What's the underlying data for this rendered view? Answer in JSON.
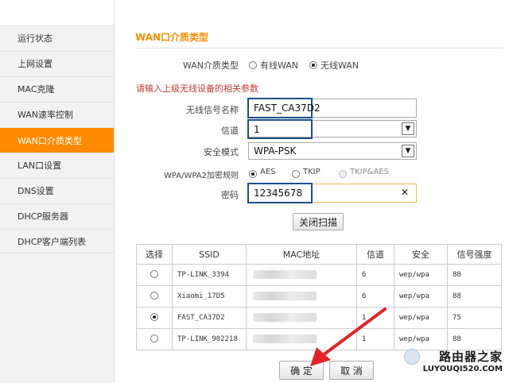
{
  "sidebar": {
    "items": [
      {
        "label": "运行状态",
        "active": false
      },
      {
        "label": "上网设置",
        "active": false
      },
      {
        "label": "MAC克隆",
        "active": false
      },
      {
        "label": "WAN速率控制",
        "active": false
      },
      {
        "label": "WAN口介质类型",
        "active": true
      },
      {
        "label": "LAN口设置",
        "active": false
      },
      {
        "label": "DNS设置",
        "active": false
      },
      {
        "label": "DHCP服务器",
        "active": false
      },
      {
        "label": "DHCP客户端列表",
        "active": false
      }
    ]
  },
  "main": {
    "title": "WAN口介质类型",
    "medium_type": {
      "label": "WAN介质类型",
      "options": [
        "有线WAN",
        "无线WAN"
      ],
      "selected": "无线WAN"
    },
    "prompt": "请输入上级无线设备的相关参数",
    "ssid": {
      "label": "无线信号名称",
      "value": "FAST_CA37D2"
    },
    "channel": {
      "label": "信道",
      "value": "1"
    },
    "security": {
      "label": "安全模式",
      "value": "WPA-PSK"
    },
    "encryption": {
      "label": "WPA/WPA2加密规则",
      "options": [
        "AES",
        "TKIP",
        "TKIP&AES"
      ],
      "selected": "AES"
    },
    "password": {
      "label": "密码",
      "value": "12345678",
      "clear_glyph": "✕"
    },
    "scan_button": "关闭扫描",
    "table": {
      "headers": [
        "选择",
        "SSID",
        "MAC地址",
        "信道",
        "安全",
        "信号强度"
      ],
      "rows": [
        {
          "ssid": "TP-LINK_3394",
          "channel": "6",
          "security": "wep/wpa",
          "signal": "88",
          "selected": false
        },
        {
          "ssid": "Xiaomi_17D5",
          "channel": "6",
          "security": "wep/wpa",
          "signal": "88",
          "selected": false
        },
        {
          "ssid": "FAST_CA37D2",
          "channel": "1",
          "security": "wep/wpa",
          "signal": "75",
          "selected": true
        },
        {
          "ssid": "TP-LINK_902218",
          "channel": "1",
          "security": "wep/wpa",
          "signal": "88",
          "selected": false
        }
      ]
    },
    "confirm_button": "确 定",
    "cancel_button": "取 消"
  },
  "watermark": {
    "line1": "路由器之家",
    "line2": "LUYOUQI520.COM"
  },
  "colors": {
    "accent": "#ff8a00",
    "highlight_border": "#1f4e8c",
    "arrow": "#e0242a",
    "prompt": "#c0392b"
  }
}
